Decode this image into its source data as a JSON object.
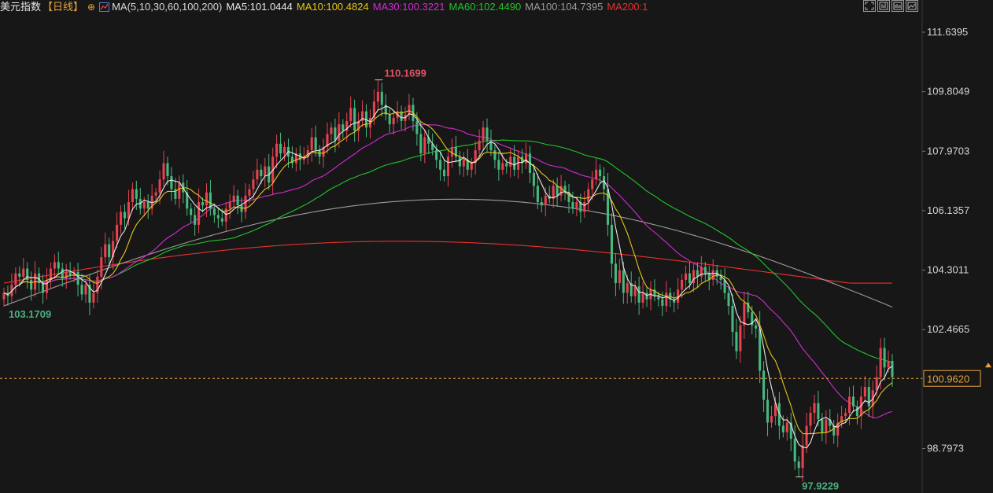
{
  "header": {
    "title": "美元指数",
    "period": "【日线】",
    "settings_glyph": "⊕",
    "ma_params": "MA(5,10,30,60,100,200)",
    "ma_values": [
      {
        "label": "MA5:101.0444",
        "color": "#e8e8e8"
      },
      {
        "label": "MA10:100.4824",
        "color": "#e6c619"
      },
      {
        "label": "MA30:100.3221",
        "color": "#d22bd2"
      },
      {
        "label": "MA60:102.4490",
        "color": "#22c42a"
      },
      {
        "label": "MA100:104.7395",
        "color": "#9c9c9c"
      },
      {
        "label": "MA200:1",
        "color": "#e8322c"
      }
    ]
  },
  "toolbar": {
    "icons": [
      "expand-icon",
      "zoom-in-icon",
      "zoom-out-icon",
      "fit-icon"
    ]
  },
  "chart_data": {
    "type": "candlestick",
    "y_axis": {
      "ticks": [
        "111.6395",
        "109.8049",
        "107.9703",
        "106.1357",
        "104.3011",
        "102.4665",
        "98.7973"
      ],
      "tick_values": [
        111.6395,
        109.8049,
        107.9703,
        106.1357,
        104.3011,
        102.4665,
        98.7973
      ],
      "ylim": [
        97.5,
        112.1
      ],
      "position": "right"
    },
    "last_price": {
      "label": "100.9620",
      "value": 100.962
    },
    "annotations": [
      {
        "label": "110.1699",
        "kind": "high",
        "value": 110.1699,
        "color": "#e05260"
      },
      {
        "label": "103.1709",
        "kind": "start-low",
        "value": 103.1709,
        "color": "#4caf7d"
      },
      {
        "label": "97.9229",
        "kind": "low",
        "value": 97.9229,
        "color": "#4caf7d"
      }
    ],
    "colors": {
      "up": "#e8414f",
      "down": "#46b97e",
      "ma5": "#e8e8e8",
      "ma10": "#e6c619",
      "ma30": "#d22bd2",
      "ma60": "#22c42a",
      "ma100": "#9c9c9c",
      "ma200": "#e8322c",
      "last_price_line": "#e8a23a"
    },
    "closes": [
      103.6,
      103.5,
      103.85,
      104.2,
      104.1,
      104.35,
      104.0,
      103.7,
      104.2,
      103.9,
      103.6,
      104.0,
      104.35,
      104.55,
      104.35,
      104.05,
      104.25,
      104.15,
      104.25,
      103.85,
      103.55,
      103.85,
      103.3,
      103.6,
      104.1,
      104.7,
      105.1,
      104.7,
      105.2,
      105.7,
      106.1,
      105.9,
      106.4,
      106.8,
      106.5,
      106.2,
      106.4,
      106.2,
      106.6,
      106.7,
      107.1,
      107.6,
      107.2,
      106.8,
      106.5,
      107.0,
      106.7,
      106.2,
      106.0,
      105.7,
      106.4,
      106.3,
      106.7,
      106.2,
      106.0,
      105.9,
      105.8,
      106.2,
      106.4,
      106.6,
      106.3,
      106.1,
      106.6,
      106.8,
      107.1,
      107.4,
      107.2,
      107.5,
      107.0,
      107.8,
      108.2,
      107.9,
      108.1,
      107.8,
      107.6,
      107.9,
      107.7,
      107.8,
      108.0,
      108.4,
      108.0,
      107.8,
      108.1,
      108.5,
      108.7,
      108.3,
      108.8,
      108.6,
      108.9,
      109.3,
      108.6,
      108.9,
      109.2,
      108.7,
      109.0,
      109.5,
      109.8,
      109.4,
      109.1,
      108.8,
      109.0,
      109.2,
      108.9,
      109.1,
      109.4,
      108.9,
      108.5,
      107.9,
      108.4,
      108.2,
      108.0,
      107.7,
      107.4,
      107.2,
      107.8,
      108.1,
      107.8,
      107.5,
      107.7,
      107.4,
      107.6,
      108.0,
      108.3,
      108.7,
      108.3,
      108.0,
      107.7,
      107.4,
      107.6,
      107.5,
      107.8,
      107.4,
      107.8,
      107.6,
      107.9,
      107.3,
      106.9,
      106.4,
      106.3,
      106.6,
      106.5,
      106.9,
      106.6,
      106.9,
      106.7,
      106.4,
      106.2,
      106.4,
      106.1,
      106.4,
      106.8,
      107.1,
      107.4,
      107.2,
      106.8,
      105.7,
      104.5,
      103.9,
      104.3,
      103.6,
      103.9,
      103.5,
      103.8,
      103.3,
      103.6,
      103.4,
      103.7,
      103.5,
      103.4,
      103.2,
      103.6,
      103.4,
      103.3,
      103.7,
      104.0,
      104.2,
      103.9,
      104.3,
      104.1,
      104.4,
      104.2,
      104.0,
      104.3,
      104.1,
      104.0,
      103.6,
      103.2,
      102.4,
      101.8,
      102.6,
      103.3,
      103.0,
      102.6,
      102.5,
      101.2,
      100.3,
      99.6,
      99.8,
      100.2,
      99.5,
      99.3,
      99.6,
      99.1,
      98.4,
      98.2,
      98.9,
      99.5,
      99.9,
      100.2,
      99.7,
      99.3,
      99.7,
      99.5,
      99.2,
      99.6,
      99.8,
      99.9,
      100.4,
      100.1,
      99.8,
      100.4,
      100.7,
      100.1,
      100.6,
      101.0,
      101.9,
      101.3,
      101.5,
      101.0
    ]
  }
}
